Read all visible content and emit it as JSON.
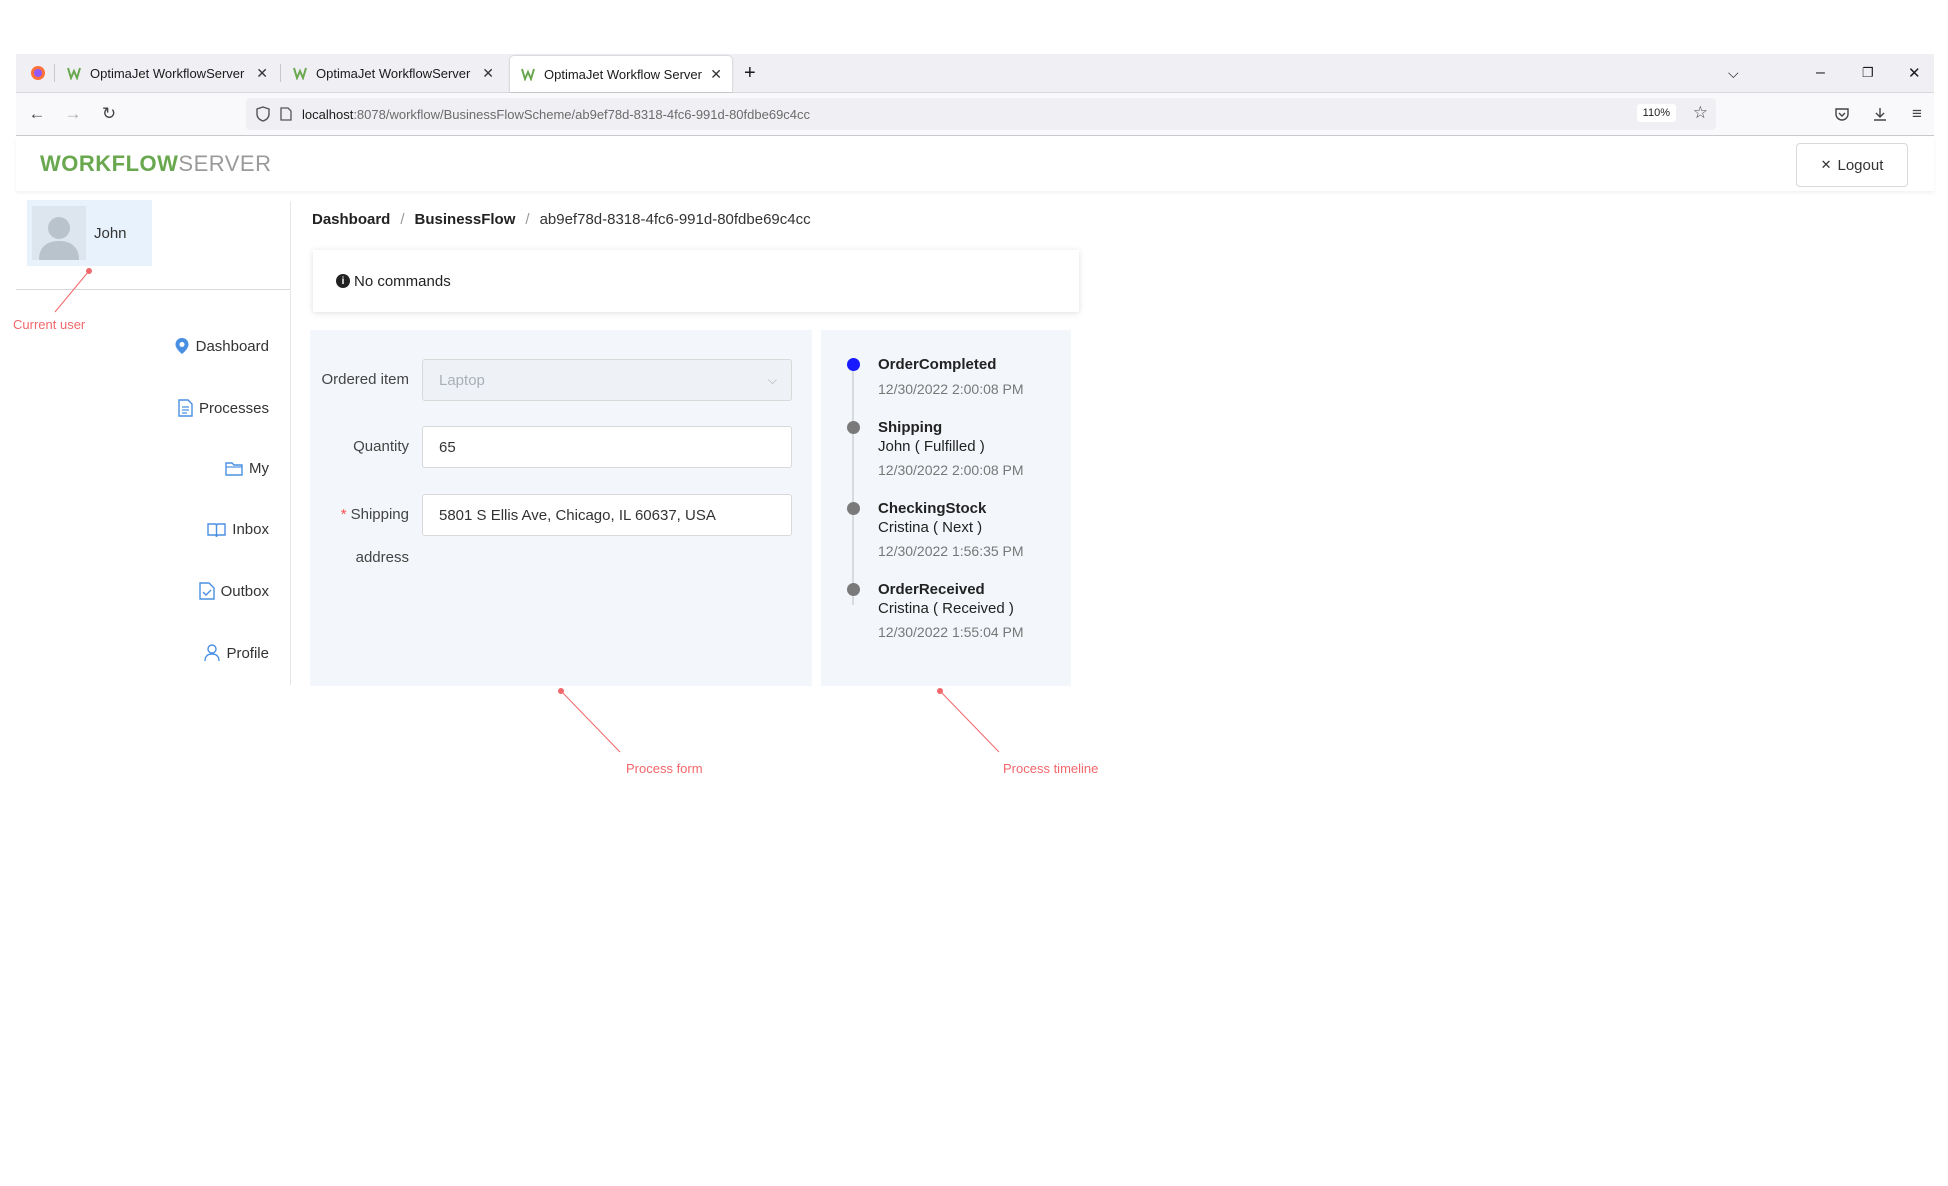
{
  "browser": {
    "tabs": [
      {
        "title": "OptimaJet WorkflowServer",
        "active": false
      },
      {
        "title": "OptimaJet WorkflowServer",
        "active": false
      },
      {
        "title": "OptimaJet Workflow Server",
        "active": true
      }
    ],
    "url_host": "localhost",
    "url_path": ":8078/workflow/BusinessFlowScheme/ab9ef78d-8318-4fc6-991d-80fdbe69c4cc",
    "zoom": "110%"
  },
  "header": {
    "logo_part1": "WORKFLOW",
    "logo_part2": "SERVER",
    "logout_label": "Logout"
  },
  "user": {
    "name": "John"
  },
  "sidebar": {
    "items": [
      {
        "label": "Dashboard",
        "icon": "pin-icon"
      },
      {
        "label": "Processes",
        "icon": "document-icon"
      },
      {
        "label": "My",
        "icon": "folder-icon"
      },
      {
        "label": "Inbox",
        "icon": "book-icon"
      },
      {
        "label": "Outbox",
        "icon": "file-check-icon"
      },
      {
        "label": "Profile",
        "icon": "user-icon"
      }
    ]
  },
  "breadcrumb": {
    "items": [
      "Dashboard",
      "BusinessFlow",
      "ab9ef78d-8318-4fc6-991d-80fdbe69c4cc"
    ]
  },
  "commands": {
    "text": "No commands"
  },
  "form": {
    "ordered_item": {
      "label": "Ordered item",
      "value": "Laptop"
    },
    "quantity": {
      "label": "Quantity",
      "value": "65"
    },
    "shipping_address": {
      "label_line1": "Shipping",
      "label_line2": "address",
      "value": "5801 S Ellis Ave, Chicago, IL 60637, USA"
    }
  },
  "timeline": [
    {
      "title": "OrderCompleted",
      "subtitle": "",
      "date": "12/30/2022 2:00:08 PM",
      "current": true
    },
    {
      "title": "Shipping",
      "subtitle": "John ( Fulfilled )",
      "date": "12/30/2022 2:00:08 PM",
      "current": false
    },
    {
      "title": "CheckingStock",
      "subtitle": "Cristina ( Next )",
      "date": "12/30/2022 1:56:35 PM",
      "current": false
    },
    {
      "title": "OrderReceived",
      "subtitle": "Cristina ( Received )",
      "date": "12/30/2022 1:55:04 PM",
      "current": false
    }
  ],
  "annotations": {
    "current_user": "Current user",
    "process_form": "Process form",
    "process_timeline": "Process timeline"
  },
  "colors": {
    "brand_green": "#6aa84f",
    "annotation_red": "#f2676b",
    "timeline_current": "#1a1aff",
    "panel_bg": "#f3f7fb"
  }
}
